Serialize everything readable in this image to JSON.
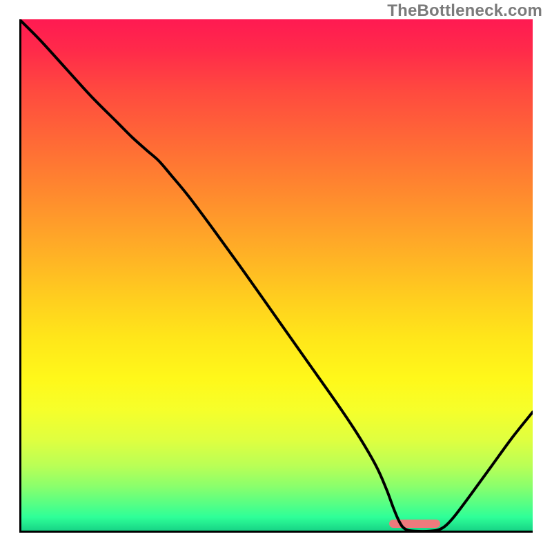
{
  "watermark": "TheBottleneck.com",
  "chart_data": {
    "type": "line",
    "title": "",
    "xlabel": "",
    "ylabel": "",
    "xlim": [
      0,
      1
    ],
    "ylim": [
      0,
      1
    ],
    "background_gradient_meaning": "red (bad) → green (good), vertical",
    "background_gradient_stops": [
      {
        "pos": 0.0,
        "color": "#ff1a52"
      },
      {
        "pos": 0.5,
        "color": "#ffcd1f"
      },
      {
        "pos": 0.8,
        "color": "#f6ff2a"
      },
      {
        "pos": 1.0,
        "color": "#14cd83"
      }
    ],
    "marker": {
      "shape": "rounded-bar",
      "color": "#ee7a7d",
      "x_center": 0.77,
      "width_frac": 0.1,
      "y_from_bottom_frac": 0.01
    },
    "curve_points_xy_frac": [
      [
        0.0,
        1.0
      ],
      [
        0.04,
        0.96
      ],
      [
        0.09,
        0.905
      ],
      [
        0.14,
        0.85
      ],
      [
        0.19,
        0.8
      ],
      [
        0.22,
        0.77
      ],
      [
        0.248,
        0.745
      ],
      [
        0.272,
        0.724
      ],
      [
        0.296,
        0.696
      ],
      [
        0.33,
        0.655
      ],
      [
        0.38,
        0.588
      ],
      [
        0.44,
        0.505
      ],
      [
        0.5,
        0.42
      ],
      [
        0.56,
        0.335
      ],
      [
        0.62,
        0.25
      ],
      [
        0.66,
        0.19
      ],
      [
        0.695,
        0.13
      ],
      [
        0.715,
        0.085
      ],
      [
        0.728,
        0.05
      ],
      [
        0.738,
        0.026
      ],
      [
        0.746,
        0.012
      ],
      [
        0.756,
        0.005
      ],
      [
        0.77,
        0.003
      ],
      [
        0.8,
        0.003
      ],
      [
        0.818,
        0.006
      ],
      [
        0.832,
        0.015
      ],
      [
        0.85,
        0.035
      ],
      [
        0.88,
        0.075
      ],
      [
        0.92,
        0.13
      ],
      [
        0.96,
        0.185
      ],
      [
        1.0,
        0.235
      ]
    ]
  }
}
